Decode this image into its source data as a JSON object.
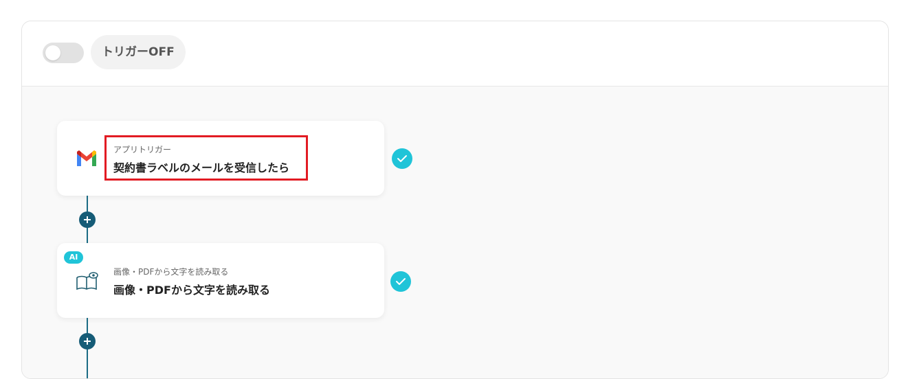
{
  "header": {
    "trigger_toggle_on": false,
    "trigger_label": "トリガーOFF"
  },
  "steps": [
    {
      "subtitle": "アプリトリガー",
      "title": "契約書ラベルのメールを受信したら",
      "icon": "gmail-icon",
      "completed": true,
      "highlighted": true
    },
    {
      "badge": "AI",
      "subtitle": "画像・PDFから文字を読み取る",
      "title": "画像・PDFから文字を読み取る",
      "icon": "ocr-book-eye-icon",
      "completed": true,
      "highlighted": false
    }
  ],
  "colors": {
    "accent": "#20c4d8",
    "connector": "#1a6b84",
    "add_button": "#165c77",
    "highlight_border": "#e21b23"
  }
}
